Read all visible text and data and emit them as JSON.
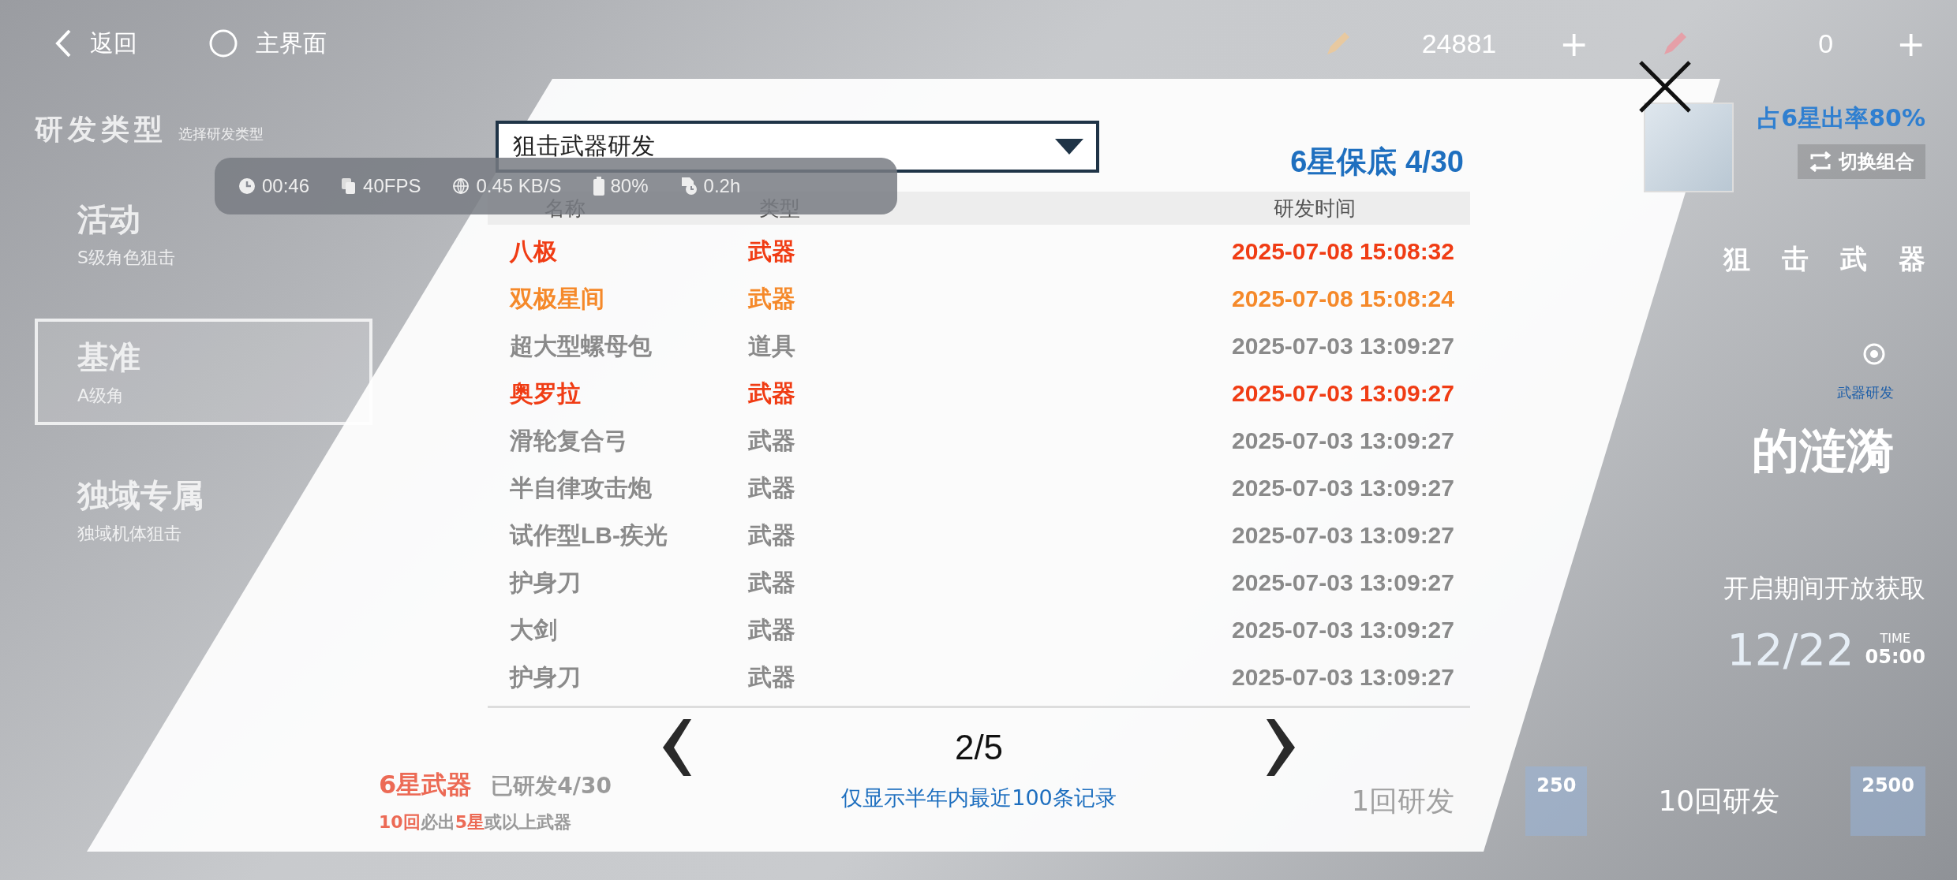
{
  "top_bar": {
    "back": "返回",
    "home": "主界面",
    "currencies": [
      {
        "amount": "24881",
        "add": "+"
      },
      {
        "amount": "0",
        "add": "+"
      }
    ]
  },
  "sidebar": {
    "title": "研发类型",
    "subtitle": "选择研发类型",
    "items": [
      {
        "label": "活动",
        "sublabel": "S级角色狙击",
        "selected": false
      },
      {
        "label": "基准",
        "sublabel": "A级角",
        "selected": true
      },
      {
        "label": "独域专属",
        "sublabel": "独域机体狙击",
        "selected": false
      }
    ]
  },
  "banner": {
    "rate": "占6星出率80%",
    "switch": "切换组合",
    "type_title": "狙击武器",
    "category": "武器研发",
    "name": "的涟漪",
    "availability": "开启期间开放获取",
    "date": "12/22",
    "time_label": "TIME",
    "time": "05:00"
  },
  "bottom": {
    "guarantee_title": "6星武器",
    "progress": "已研发4/30",
    "rule": "**10回**必出**5星**或以上武器",
    "single_pull": "1回研发",
    "single_cost": "250",
    "multi_pull": "10回研发",
    "multi_cost": "2500"
  },
  "perf": {
    "time": "00:46",
    "fps": "40FPS",
    "net": "0.45 KB/S",
    "battery": "80%",
    "session": "0.2h"
  },
  "dialog": {
    "dropdown": "狙击武器研发",
    "pity": "6星保底 4/30",
    "columns": [
      "名称",
      "类型",
      "研发时间"
    ],
    "rows": [
      {
        "name": "八极",
        "type": "武器",
        "time": "2025-07-08 15:08:32",
        "color": "#f03c14"
      },
      {
        "name": "双极星间",
        "type": "武器",
        "time": "2025-07-08 15:08:24",
        "color": "#f5892a"
      },
      {
        "name": "超大型螺母包",
        "type": "道具",
        "time": "2025-07-03 13:09:27",
        "color": "#8a8a8a"
      },
      {
        "name": "奥罗拉",
        "type": "武器",
        "time": "2025-07-03 13:09:27",
        "color": "#f03c14"
      },
      {
        "name": "滑轮复合弓",
        "type": "武器",
        "time": "2025-07-03 13:09:27",
        "color": "#8a8a8a"
      },
      {
        "name": "半自律攻击炮",
        "type": "武器",
        "time": "2025-07-03 13:09:27",
        "color": "#8a8a8a"
      },
      {
        "name": "试作型LB-疾光",
        "type": "武器",
        "time": "2025-07-03 13:09:27",
        "color": "#8a8a8a"
      },
      {
        "name": "护身刀",
        "type": "武器",
        "time": "2025-07-03 13:09:27",
        "color": "#8a8a8a"
      },
      {
        "name": "大剑",
        "type": "武器",
        "time": "2025-07-03 13:09:27",
        "color": "#8a8a8a"
      },
      {
        "name": "护身刀",
        "type": "武器",
        "time": "2025-07-03 13:09:27",
        "color": "#8a8a8a"
      }
    ],
    "page": "2/5",
    "note": "仅显示半年内最近100条记录"
  }
}
